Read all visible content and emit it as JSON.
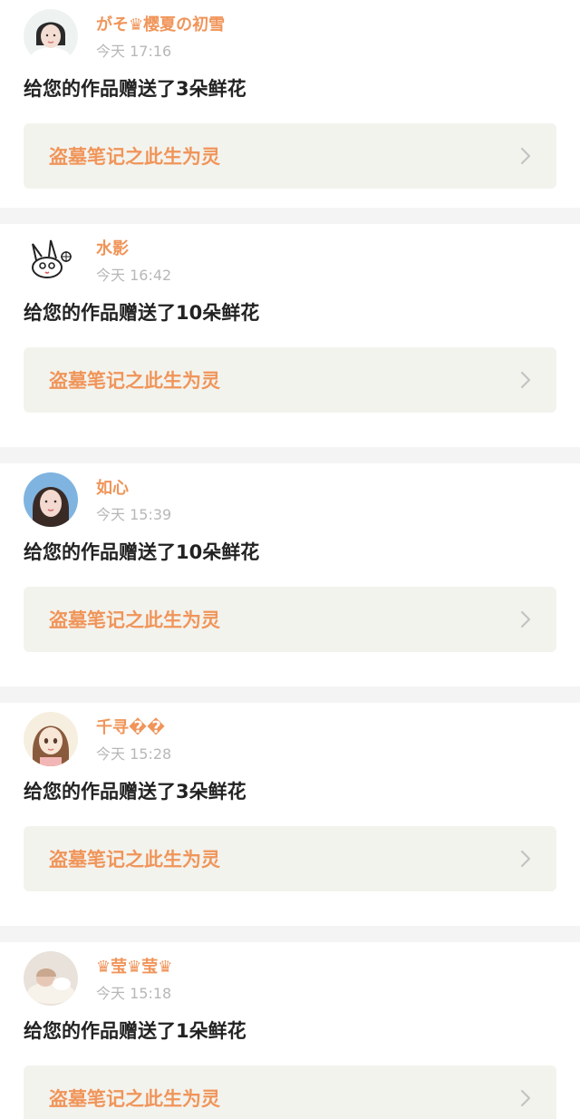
{
  "items": [
    {
      "user": "がそ♛樱夏の初雪",
      "time": "今天 17:16",
      "message": "给您的作品赠送了3朵鲜花",
      "work": "盗墓笔记之此生为灵",
      "avatar": "photo-girl-white"
    },
    {
      "user": "水影",
      "time": "今天 16:42",
      "message": "给您的作品赠送了10朵鲜花",
      "work": "盗墓笔记之此生为灵",
      "avatar": "rabbit-sketch"
    },
    {
      "user": "如心",
      "time": "今天 15:39",
      "message": "给您的作品赠送了10朵鲜花",
      "work": "盗墓笔记之此生为灵",
      "avatar": "photo-girl-blue"
    },
    {
      "user": "千寻��",
      "time": "今天 15:28",
      "message": "给您的作品赠送了3朵鲜花",
      "work": "盗墓笔记之此生为灵",
      "avatar": "anime-girl"
    },
    {
      "user": "♛莹♛莹♛",
      "time": "今天 15:18",
      "message": "给您的作品赠送了1朵鲜花",
      "work": "盗墓笔记之此生为灵",
      "avatar": "photo-sleeping"
    }
  ],
  "colors": {
    "accent": "#f0955a",
    "time": "#b7b7b7",
    "work_bg": "#f3f3ee",
    "separator": "#f4f4f4"
  }
}
